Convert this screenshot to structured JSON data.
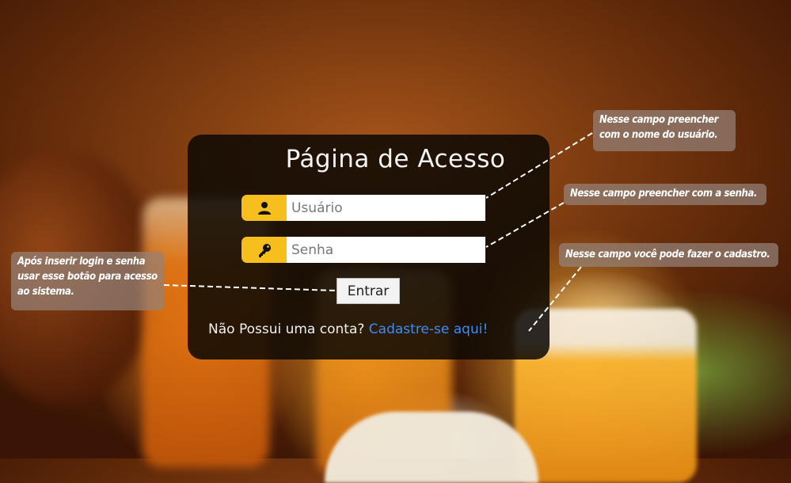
{
  "login": {
    "title": "Página de Acesso",
    "username_placeholder": "Usuário",
    "password_placeholder": "Senha",
    "submit_label": "Entrar",
    "signup_prompt": "Não Possui uma conta?",
    "signup_link": "Cadastre-se aqui!"
  },
  "annotations": {
    "username_note_line1": "Nesse campo preencher",
    "username_note_line2": "com o  nome do usuário.",
    "password_note": "Nesse campo preencher com a senha.",
    "signup_note": "Nesse campo você pode fazer o cadastro.",
    "button_note_line1": "Após inserir login e senha",
    "button_note_line2": "usar esse botão para acesso",
    "button_note_line3": "ao sistema."
  },
  "icons": {
    "username": "user-icon",
    "password": "key-icon"
  },
  "colors": {
    "icon_bg": "#f6bf1d",
    "link": "#3b8cf5",
    "panel": "#0c0804"
  }
}
